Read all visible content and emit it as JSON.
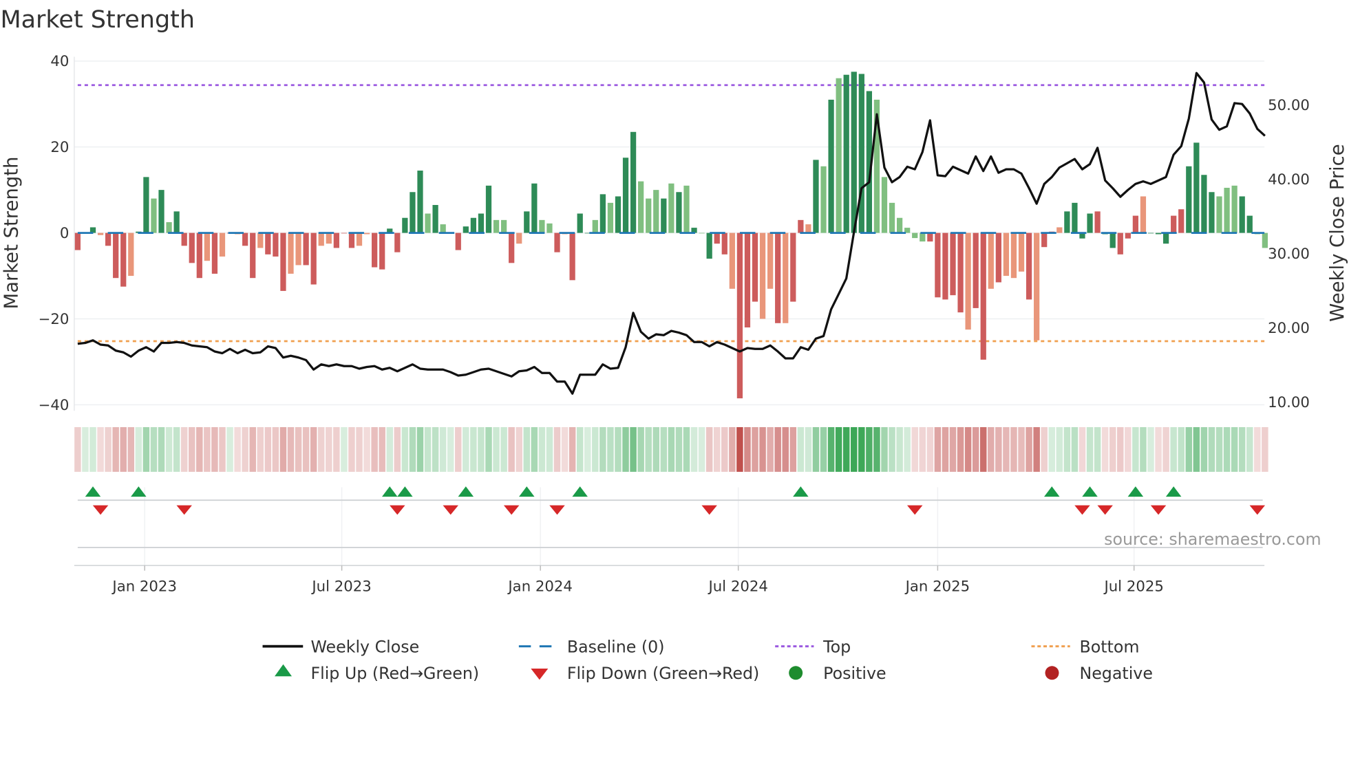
{
  "chart_data": {
    "type": "bar",
    "title": "Market Strength",
    "ylabel": "Market Strength",
    "y2label": "Weekly Close Price",
    "ylim": [
      -42,
      42
    ],
    "y_ticks": [
      40,
      20,
      0,
      -20,
      -40
    ],
    "y_tick_labels": [
      "40",
      "20",
      "0",
      "−20",
      "−40"
    ],
    "y2lim": [
      8.2,
      57.6
    ],
    "y2_ticks": [
      50,
      40,
      30,
      20,
      10
    ],
    "y2_tick_labels": [
      "50.00",
      "40.00",
      "30.00",
      "20.00",
      "10.00"
    ],
    "x_tick_labels": [
      "Jan 2023",
      "Jul 2023",
      "Jan 2024",
      "Jul 2024",
      "Jan 2025",
      "Jul 2025"
    ],
    "x_tick_week_index": [
      8.8,
      34.7,
      60.8,
      86.8,
      113,
      138.8
    ],
    "top_level": 34.4,
    "bottom_level": -25.2,
    "baseline": 0,
    "colors": {
      "strong_pos": "#2e8b57",
      "weak_pos": "#80bf80",
      "strong_neg": "#cd5c5c",
      "weak_neg": "#e9967a",
      "close": "#111111",
      "baseline": "#1f77b4",
      "top": "#9b59e0",
      "bottom": "#f0a050",
      "flip_up": "#1a9a48",
      "flip_down": "#d62728",
      "positive": "#1e8c2e",
      "negative": "#b22222"
    },
    "strength": [
      -4,
      0,
      1.3,
      -0.5,
      -3,
      -10.5,
      -12.5,
      -10,
      0.3,
      13,
      8,
      10,
      2.5,
      5,
      -3,
      -7,
      -10.5,
      -6.5,
      -9.5,
      -5.5,
      0,
      -0.3,
      -3,
      -10.5,
      -3.5,
      -5,
      -5.5,
      -13.5,
      -9.5,
      -7.5,
      -7.5,
      -12,
      -3,
      -2.5,
      -3.5,
      0,
      -3.5,
      -3,
      -0.3,
      -8,
      -8.5,
      1,
      -4.5,
      3.5,
      9.5,
      14.5,
      4.5,
      6.5,
      2,
      0,
      -4,
      1.5,
      3.5,
      4.5,
      11,
      3,
      3,
      -7,
      -2.5,
      5,
      11.5,
      3,
      2.2,
      -4.5,
      -0.3,
      -11,
      4.5,
      0,
      3,
      9,
      7,
      8.5,
      17.5,
      23.5,
      12,
      8,
      10,
      8,
      11.5,
      9.5,
      11,
      1.2,
      0,
      -6,
      -2.5,
      -5,
      -13,
      -38.5,
      -22,
      -16,
      -20,
      -13,
      -21,
      -21,
      -16,
      3,
      2,
      17,
      15.5,
      31,
      36,
      36.8,
      37.5,
      37,
      33,
      31,
      13,
      7,
      3.5,
      1.2,
      -1.2,
      -2,
      -2,
      -15,
      -15.5,
      -14.5,
      -18.5,
      -22.5,
      -17.5,
      -29.5,
      -13,
      -11.5,
      -10,
      -10.5,
      -9,
      -15.5,
      -25,
      -3.3,
      0.3,
      1.3,
      5,
      7,
      -1.3,
      4.5,
      5,
      -0.3,
      -3.5,
      -5,
      -1.3,
      4,
      8.5,
      0,
      -0.3,
      -2.5,
      4,
      5.5,
      15.5,
      21,
      13.5,
      9.5,
      8.5,
      10.5,
      11,
      8.5,
      4,
      -0.3,
      -3.5
    ],
    "strength_shade": "RRGrRRRrGGgGgGRRRrRrRrRRrRRRrrRRrrRRRrrRRGRGGGgGgGRGGGGggRrGGggRrRGGgGgGGGgggGgGgGgGRRrRRRrrRrRRrGgGgGGGGgggggggRRRRRrRRrRrrrRrRRrGGGGRGGRRRrGGGRRGGGGgggGGggRR",
    "weekly_close": [
      17.86,
      17.98,
      18.32,
      17.75,
      17.63,
      16.94,
      16.71,
      16.13,
      16.94,
      17.4,
      16.82,
      17.98,
      17.98,
      18.09,
      17.98,
      17.63,
      17.51,
      17.4,
      16.82,
      16.59,
      17.17,
      16.59,
      17.05,
      16.59,
      16.71,
      17.51,
      17.28,
      16.01,
      16.24,
      16.01,
      15.66,
      14.39,
      15.09,
      14.86,
      15.09,
      14.86,
      14.86,
      14.51,
      14.74,
      14.86,
      14.39,
      14.62,
      14.16,
      14.62,
      15.09,
      14.51,
      14.39,
      14.39,
      14.39,
      14.05,
      13.58,
      13.7,
      14.05,
      14.39,
      14.51,
      14.16,
      13.82,
      13.47,
      14.16,
      14.28,
      14.74,
      13.93,
      13.93,
      12.77,
      12.77,
      11.16,
      13.7,
      13.7,
      13.7,
      15.09,
      14.51,
      14.62,
      17.4,
      22.02,
      19.48,
      18.55,
      19.13,
      19.02,
      19.6,
      19.36,
      19.02,
      18.09,
      18.09,
      17.51,
      18.09,
      17.75,
      17.28,
      16.82,
      17.28,
      17.17,
      17.17,
      17.63,
      16.82,
      15.9,
      15.9,
      17.4,
      17.05,
      18.55,
      18.9,
      22.49,
      24.57,
      26.65,
      32.89,
      38.79,
      39.6,
      48.73,
      41.56,
      39.6,
      40.29,
      41.68,
      41.33,
      43.64,
      47.92,
      40.52,
      40.4,
      41.68,
      41.21,
      40.75,
      43.06,
      41.1,
      43.06,
      40.87,
      41.33,
      41.33,
      40.75,
      38.79,
      36.71,
      39.36,
      40.29,
      41.56,
      42.14,
      42.72,
      41.33,
      42.02,
      44.22,
      39.83,
      38.79,
      37.63,
      38.55,
      39.36,
      39.71,
      39.36,
      39.83,
      40.29,
      43.29,
      44.45,
      48.15,
      54.28,
      53.01,
      48.03,
      46.65,
      47.11,
      50.23,
      50.12,
      48.84,
      46.76,
      45.84
    ],
    "flip_up_week_index": [
      2,
      8,
      41,
      43,
      51,
      59,
      66,
      95,
      128,
      133,
      139,
      144
    ],
    "flip_down_week_index": [
      3,
      14,
      42,
      49,
      57,
      63,
      83,
      110,
      132,
      135,
      142,
      155
    ],
    "legend_position": "bottom",
    "legend": {
      "close": "Weekly Close",
      "baseline": "Baseline (0)",
      "top": "Top",
      "bottom": "Bottom",
      "flip_up": "Flip Up (Red→Green)",
      "flip_down": "Flip Down (Green→Red)",
      "positive": "Positive",
      "negative": "Negative"
    },
    "source": "source: sharemaestro.com"
  }
}
